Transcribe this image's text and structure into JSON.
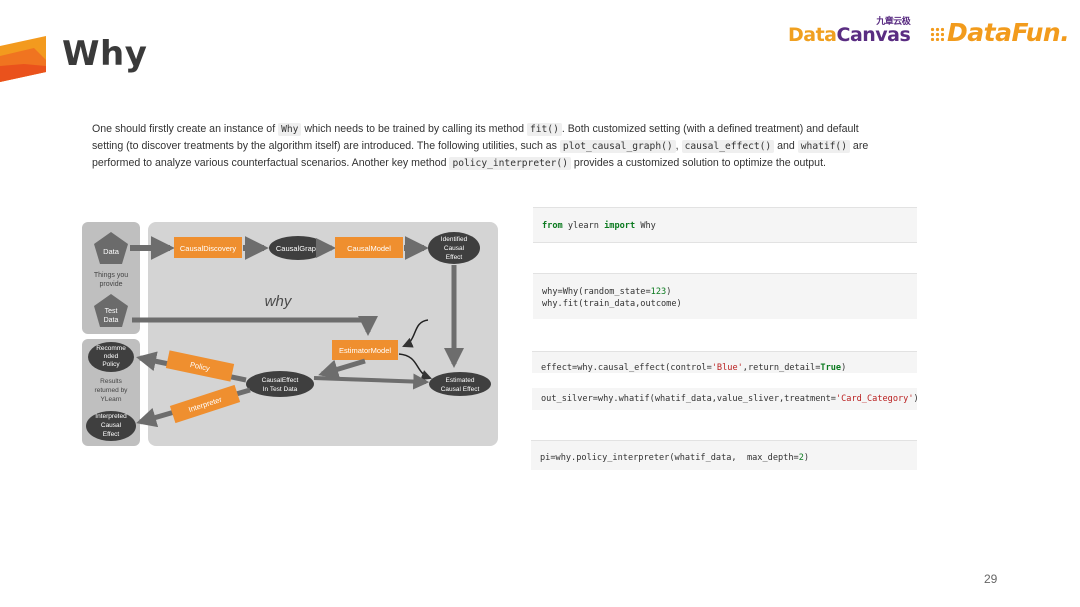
{
  "slide": {
    "title": "Why",
    "page_number": "29"
  },
  "logos": {
    "datacanvas": {
      "part1": "Data",
      "part2": "Canvas",
      "chinese": "九章云极"
    },
    "datafun": "DataFun."
  },
  "paragraph": {
    "t1": "One should firstly create an instance of ",
    "c1": "Why",
    "t2": " which needs to be trained by calling its method ",
    "c2": "fit()",
    "t3": ". Both customized setting (with a defined treatment) and default setting (to discover treatments by the algorithm itself) are introduced. The following utilities, such as ",
    "c3": "plot_causal_graph()",
    "t4": ", ",
    "c4": "causal_effect()",
    "t5": " and ",
    "c5": "whatif()",
    "t6": " are performed to analyze various counterfactual scenarios. Another key method ",
    "c6": "policy_interpreter()",
    "t7": " provides a customized solution to optimize the output."
  },
  "diagram": {
    "data": "Data",
    "things_you_provide_1": "Things you",
    "things_you_provide_2": "provide",
    "test_data_1": "Test",
    "test_data_2": "Data",
    "recommended_1": "Recomme",
    "recommended_2": "nded",
    "recommended_3": "Policy",
    "results_1": "Results",
    "results_2": "returned by",
    "results_3": "YLearn",
    "interpreted_1": "Interpreted",
    "interpreted_2": "Causal",
    "interpreted_3": "Effect",
    "causal_discovery": "CausalDiscovery",
    "causal_graph": "CausalGraph",
    "causal_model": "CausalModel",
    "identified_1": "Identified",
    "identified_2": "Causal",
    "identified_3": "Effect",
    "why_label": "why",
    "estimator_model": "EstimatorModel",
    "policy": "Policy",
    "causal_effect_test_1": "CausalEffect",
    "causal_effect_test_2": "In Test Data",
    "estimated_1": "Estimated",
    "estimated_2": "Causal Effect",
    "interpreter": "Interpreter",
    "colors": {
      "orange": "#ef8f2f",
      "dark_node": "#3f3f3f",
      "panel": "#d4d4d4",
      "left_panel": "#bfbfbf",
      "arrow": "#6d6d6d"
    }
  },
  "code": {
    "block1": {
      "kw1": "from",
      "mod": " ylearn ",
      "kw2": "import",
      "name": " Why"
    },
    "block2": {
      "l1a": "why=Why(random_state=",
      "l1n": "123",
      "l1b": ")",
      "l2": "why.fit(train_data,outcome)"
    },
    "block3": {
      "a": "effect=why.causal_effect(control=",
      "s": "'Blue'",
      "b": ",return_detail=",
      "k": "True",
      "c": ")"
    },
    "block4": {
      "a": "out_silver=why.whatif(whatif_data,value_sliver,treatment=",
      "s": "'Card_Category'",
      "b": ")"
    },
    "block5": {
      "a": "pi=why.policy_interpreter(whatif_data,  max_depth=",
      "n": "2",
      "b": ")"
    }
  }
}
